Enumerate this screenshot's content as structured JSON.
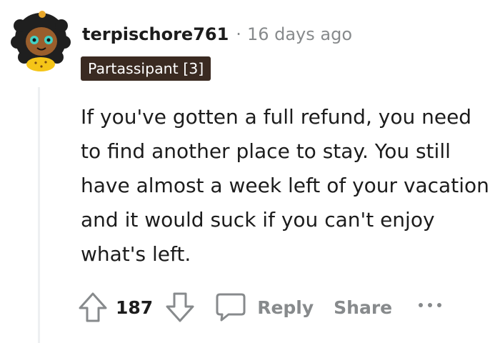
{
  "comment": {
    "username": "terpischore761",
    "separator": "·",
    "age": "16 days ago",
    "flair": "Partassipant [3]",
    "body": "If you've gotten a full refund, you need to find another place to stay. You still have almost a week left of your vacation and it would suck if you can't enjoy what's left.",
    "avatar_icon": "snoo-avatar"
  },
  "actions": {
    "upvote_icon": "upvote-arrow-icon",
    "score": "187",
    "downvote_icon": "downvote-arrow-icon",
    "reply_icon": "speech-bubble-icon",
    "reply_label": "Reply",
    "share_label": "Share",
    "more_icon": "ellipsis-icon"
  },
  "colors": {
    "text": "#1c1c1c",
    "muted": "#878a8c",
    "flair_bg": "#3a2a21",
    "flair_text": "#ffffff",
    "thread_line": "#edeff1",
    "avatar_yellow": "#f5c518",
    "avatar_hair": "#1f1f1f"
  }
}
